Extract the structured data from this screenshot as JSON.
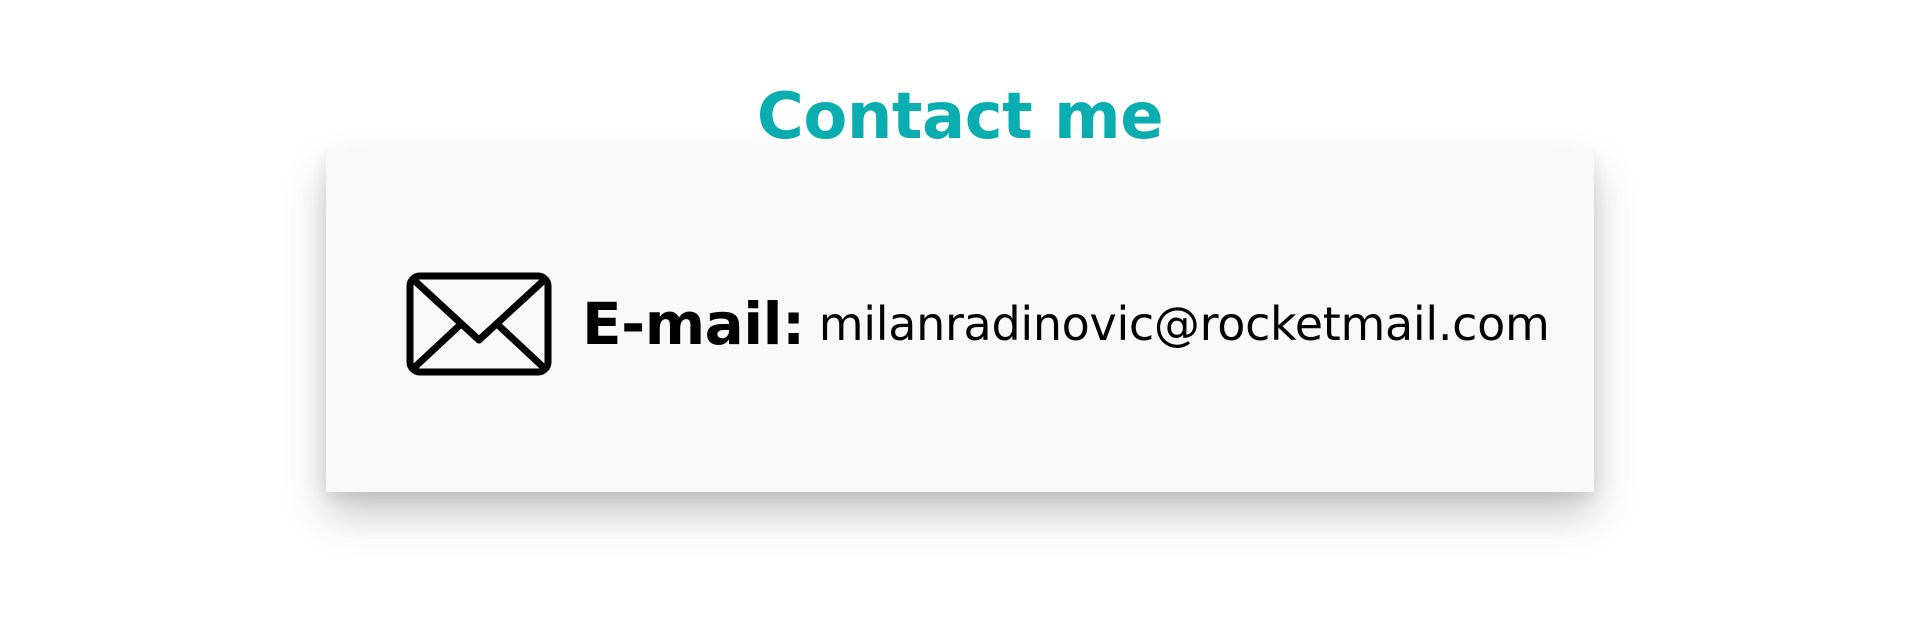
{
  "section": {
    "title": "Contact me",
    "title_color": "#0aaeb0"
  },
  "contact": {
    "icon": "envelope-icon",
    "email_label": "E-mail:",
    "email_value": "milanradinovic@rocketmail.com"
  }
}
